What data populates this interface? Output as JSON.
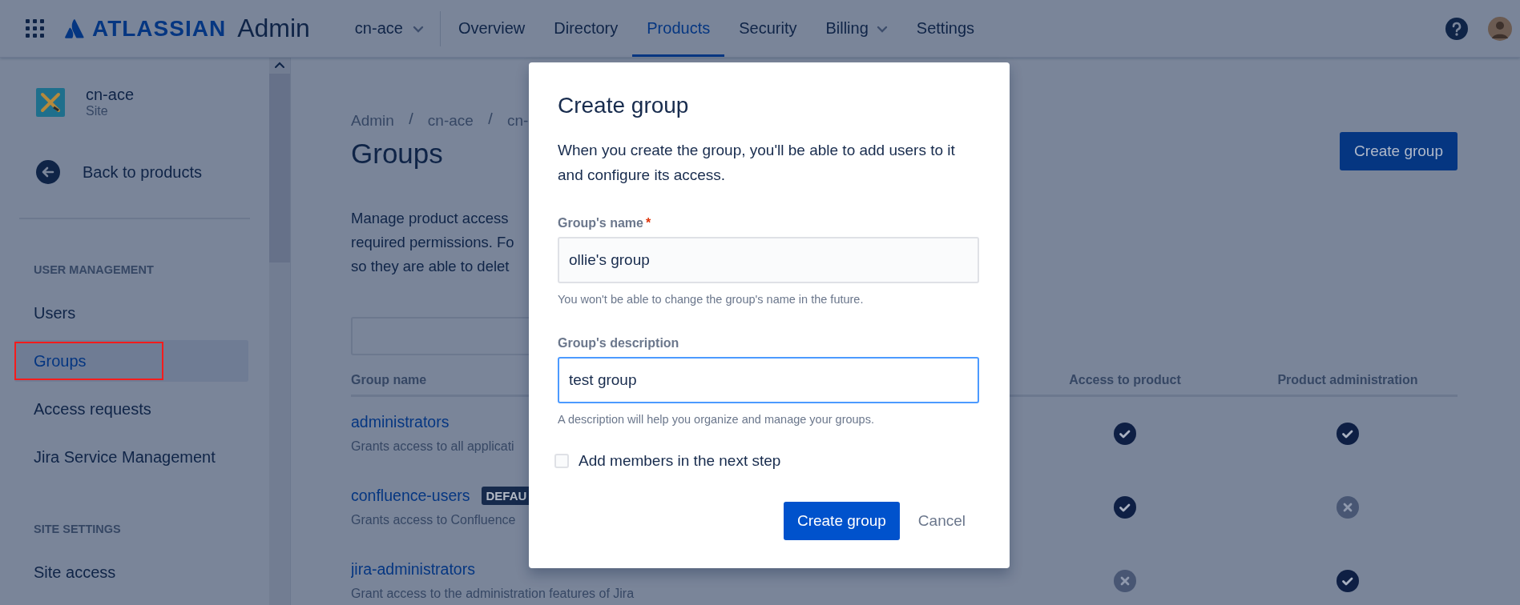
{
  "top_bar": {
    "brand": "ATLASSIAN",
    "product": "Admin",
    "site_switcher": "cn-ace",
    "nav": [
      {
        "label": "Overview",
        "selected": false,
        "dropdown": false
      },
      {
        "label": "Directory",
        "selected": false,
        "dropdown": false
      },
      {
        "label": "Products",
        "selected": true,
        "dropdown": false
      },
      {
        "label": "Security",
        "selected": false,
        "dropdown": false
      },
      {
        "label": "Billing",
        "selected": false,
        "dropdown": true
      },
      {
        "label": "Settings",
        "selected": false,
        "dropdown": false
      }
    ]
  },
  "sidebar": {
    "site": {
      "name": "cn-ace",
      "type": "Site"
    },
    "back_link": "Back to products",
    "sections": [
      {
        "heading": "USER MANAGEMENT",
        "items": [
          {
            "label": "Users",
            "selected": false,
            "highlighted": false
          },
          {
            "label": "Groups",
            "selected": true,
            "highlighted": true
          },
          {
            "label": "Access requests",
            "selected": false,
            "highlighted": false
          },
          {
            "label": "Jira Service Management",
            "selected": false,
            "highlighted": false
          }
        ]
      },
      {
        "heading": "SITE SETTINGS",
        "items": [
          {
            "label": "Site access",
            "selected": false,
            "highlighted": false
          }
        ]
      }
    ]
  },
  "page": {
    "breadcrumbs": [
      "Admin",
      "cn-ace",
      "cn-"
    ],
    "title": "Groups",
    "create_button": "Create group",
    "description": "Manage product access\nrequired permissions. Fo\nso they are able to delet",
    "table": {
      "columns": [
        "Group name",
        "Access to product",
        "Product administration"
      ],
      "rows": [
        {
          "name": "administrators",
          "description": "Grants access to all applicati",
          "access": true,
          "admin": true
        },
        {
          "name": "confluence-users",
          "badge": "DEFAU",
          "description": "Grants access to Confluence",
          "access": true,
          "admin": false
        },
        {
          "name": "jira-administrators",
          "description": "Grant access to the administration features of Jira",
          "access": false,
          "admin": true
        }
      ]
    }
  },
  "dialog": {
    "title": "Create group",
    "intro": "When you create the group, you'll be able to add users to it and configure its access.",
    "fields": [
      {
        "label": "Group's name",
        "required_mark": "*",
        "value": "ollie's group",
        "help": "You won't be able to change the group's name in the future.",
        "focused": false
      },
      {
        "label": "Group's description",
        "value": "test group",
        "help": "A description will help you organize and manage your groups.",
        "focused": true
      }
    ],
    "checkbox": {
      "label": "Add members in the next step",
      "checked": false
    },
    "buttons": [
      {
        "label": "Create group",
        "kind": "primary"
      },
      {
        "label": "Cancel",
        "kind": "subtle"
      }
    ]
  }
}
